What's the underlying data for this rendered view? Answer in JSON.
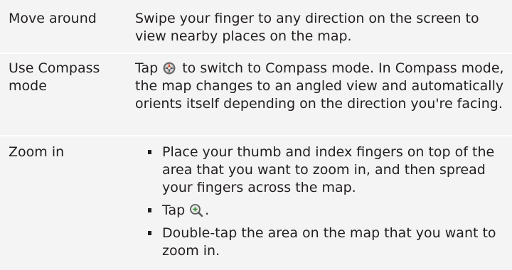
{
  "rows": [
    {
      "term": "Move around",
      "description": "Swipe your finger to any direction on the screen to view nearby places on the map."
    },
    {
      "term": "Use Compass mode",
      "description_before_icon": "Tap",
      "icon": "compass-icon",
      "description_after_icon": " to switch to Compass mode. In Compass mode, the map changes to an angled view and automatically orients itself depending on the direction you're facing."
    },
    {
      "term": "Zoom in",
      "bullets": [
        {
          "text": "Place your thumb and index fingers on top of the area that you want to zoom in, and then spread your fingers across the map."
        },
        {
          "text_before_icon": "Tap",
          "icon": "zoom-in-icon",
          "text_after_icon": "."
        },
        {
          "text": "Double-tap the area on the map that you want to zoom in."
        }
      ]
    }
  ],
  "colors": {
    "cell_background": "#f4f4f4",
    "row_divider": "#ffffff",
    "text": "#231f20"
  }
}
